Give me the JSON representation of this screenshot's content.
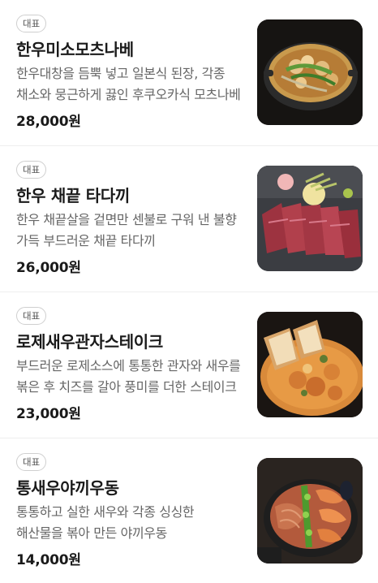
{
  "menu": {
    "items": [
      {
        "badge": "대표",
        "title": "한우미소모츠나베",
        "description": "한우대창을 듬뿍 넣고 일본식 된장, 각종 채소와 뭉근하게 끓인 후쿠오카식 모츠나베",
        "price": "28,000원",
        "image_icon": "hot-pot-photo"
      },
      {
        "badge": "대표",
        "title": "한우 채끝 타다끼",
        "description": "한우 채끝살을 겉면만 센불로 구워 낸 불향 가득 부드러운 채끝 타다끼",
        "price": "26,000원",
        "image_icon": "beef-tataki-photo"
      },
      {
        "badge": "대표",
        "title": "로제새우관자스테이크",
        "description": "부드러운 로제소스에 통통한 관자와 새우를 볶은 후 치즈를 갈아 풍미를 더한 스테이크",
        "price": "23,000원",
        "image_icon": "rose-shrimp-scallop-photo"
      },
      {
        "badge": "대표",
        "title": "통새우야끼우동",
        "description": "통통하고 실한 새우와 각종 싱싱한 해산물을 볶아 만든 야끼우동",
        "price": "14,000원",
        "image_icon": "yaki-udon-photo"
      }
    ]
  }
}
